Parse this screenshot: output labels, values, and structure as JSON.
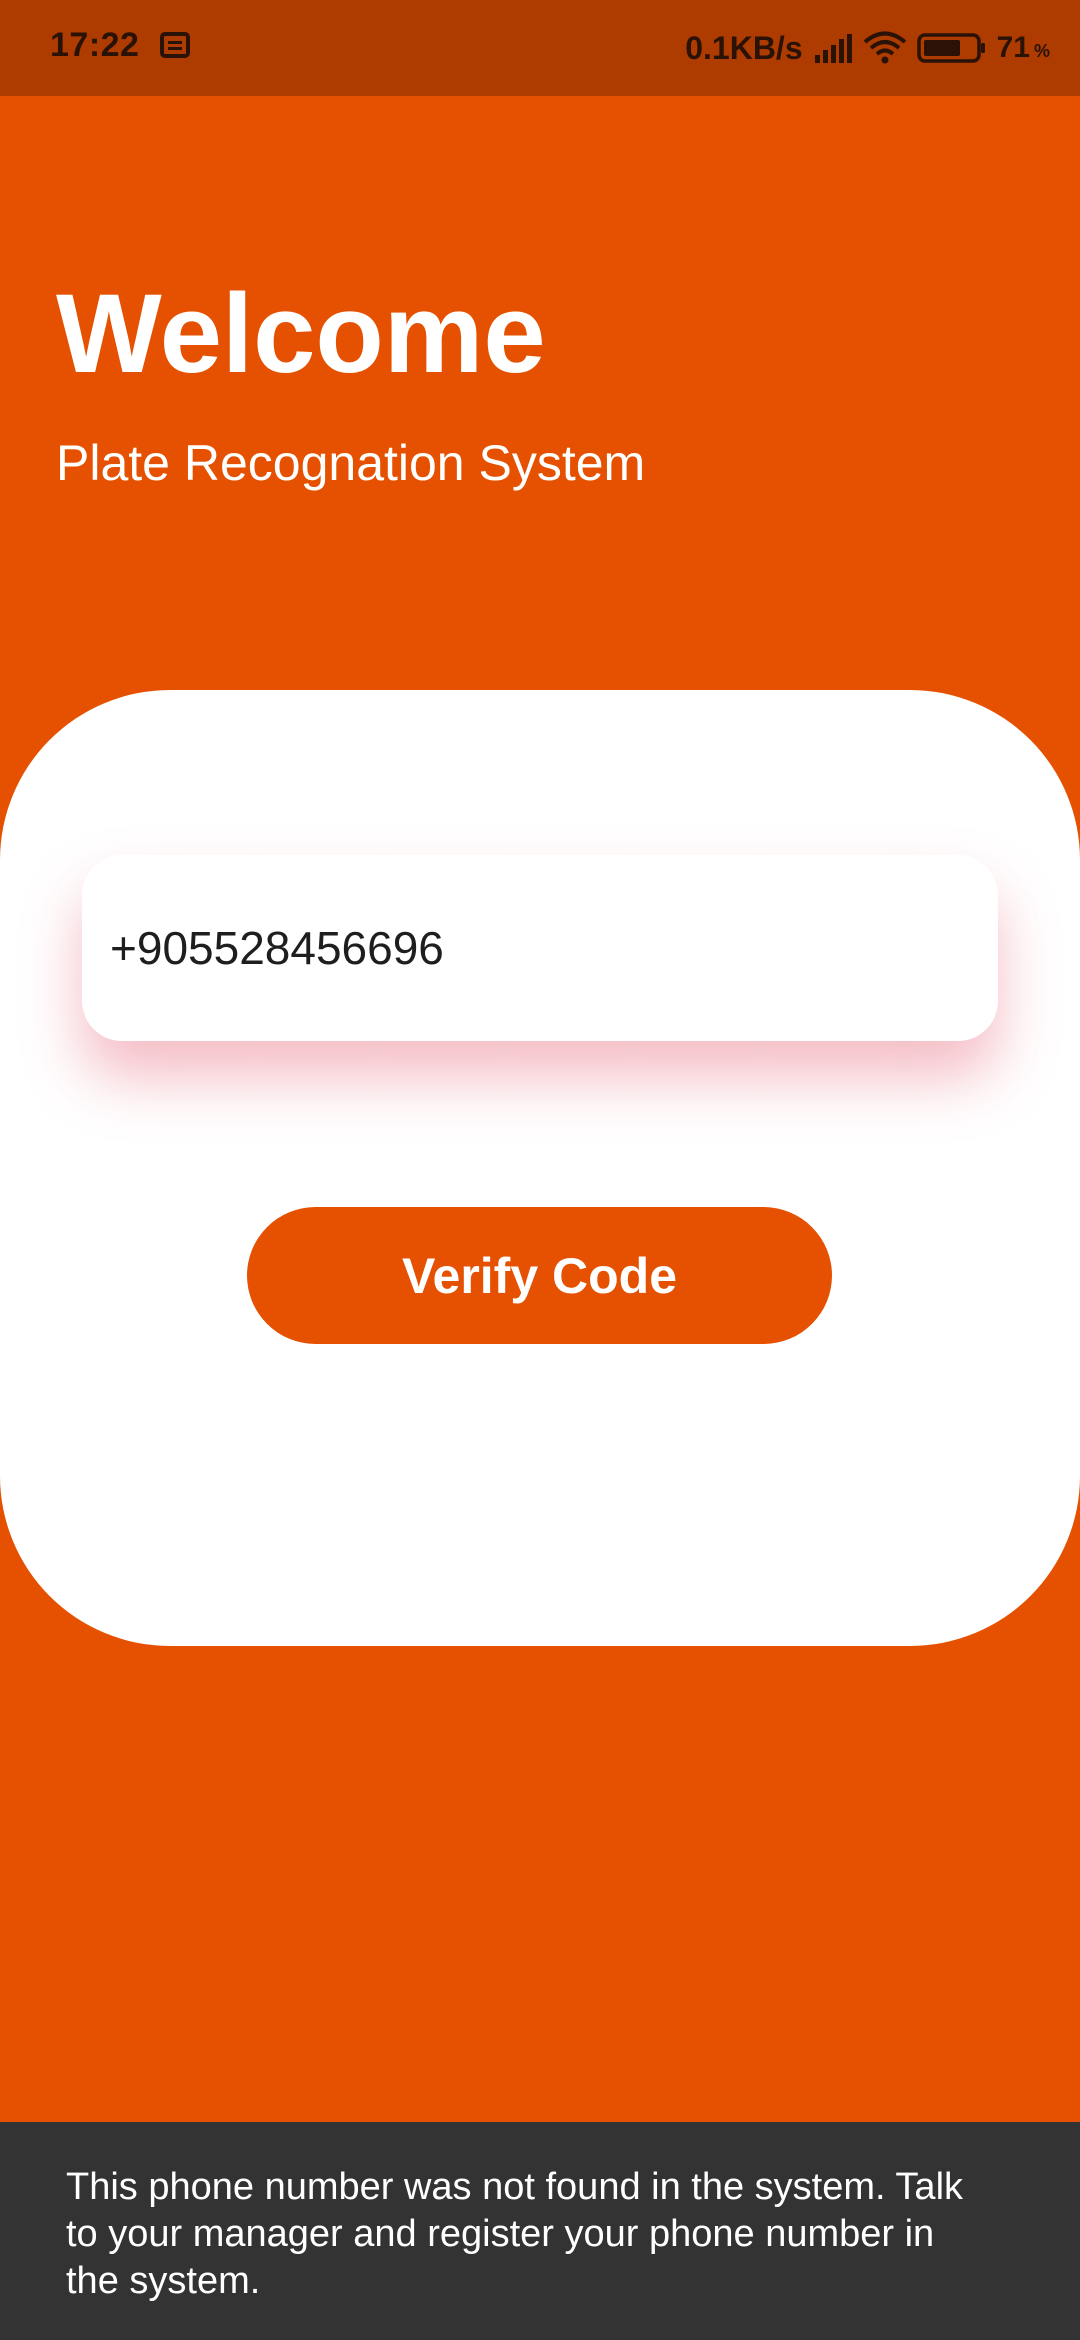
{
  "status_bar": {
    "time": "17:22",
    "network_speed": "0.1KB/s",
    "battery_percent": "71",
    "battery_unit": "%",
    "battery_level": 0.71,
    "icons": [
      "message-icon",
      "signal-icon",
      "wifi-icon",
      "battery-icon"
    ]
  },
  "header": {
    "title": "Welcome",
    "subtitle": "Plate Recognation System"
  },
  "form": {
    "phone_value": "+905528456696",
    "verify_button_label": "Verify Code"
  },
  "snackbar": {
    "message": "This phone number was not found in the system. Talk to your manager and register your phone number in the system."
  },
  "colors": {
    "primary": "#E55100",
    "status_bar": "#AE3C00",
    "card": "#FFFFFF",
    "snackbar": "#333333",
    "field_shadow": "#E25064"
  }
}
